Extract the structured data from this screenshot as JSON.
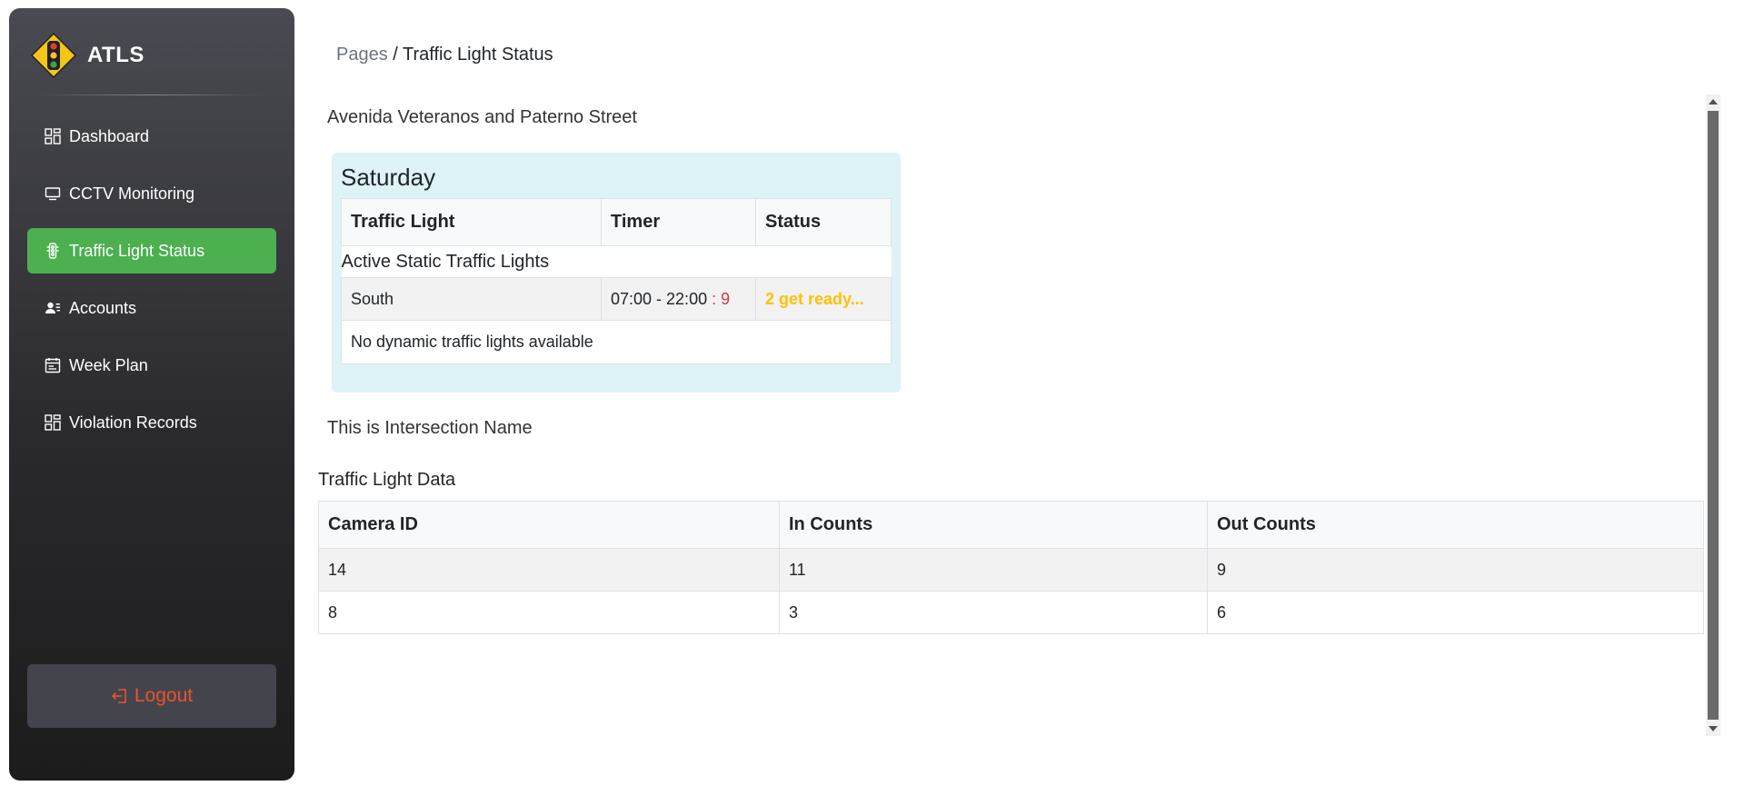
{
  "app": {
    "name": "ATLS",
    "colors": {
      "accent": "#4caf50",
      "logout": "#e8542c",
      "card_bg": "#ddf3f5",
      "status_warning": "#ffc107",
      "timer_remaining": "#dc3545"
    }
  },
  "sidebar": {
    "items": [
      {
        "label": "Dashboard",
        "icon": "dashboard-icon"
      },
      {
        "label": "CCTV Monitoring",
        "icon": "monitor-icon"
      },
      {
        "label": "Traffic Light Status",
        "icon": "traffic-light-icon",
        "active": true
      },
      {
        "label": "Accounts",
        "icon": "accounts-icon"
      },
      {
        "label": "Week Plan",
        "icon": "calendar-icon"
      },
      {
        "label": "Violation Records",
        "icon": "records-icon"
      }
    ],
    "logout_label": "Logout"
  },
  "breadcrumb": {
    "parent": "Pages",
    "separator": " / ",
    "current": "Traffic Light Status"
  },
  "main": {
    "intersection_title": "Avenida Veteranos and Paterno Street",
    "schedule": {
      "day": "Saturday",
      "headers": [
        "Traffic Light",
        "Timer",
        "Status"
      ],
      "static_section_label": "Active Static Traffic Lights",
      "static_rows": [
        {
          "light": "South",
          "timer": "07:00 - 22:00",
          "timer_sep": " : ",
          "remaining": "9",
          "status": "2 get ready..."
        }
      ],
      "dynamic_empty": "No dynamic traffic lights available"
    },
    "intersection_name": "This is Intersection Name",
    "data_title": "Traffic Light Data",
    "data_headers": [
      "Camera ID",
      "In Counts",
      "Out Counts"
    ],
    "data_rows": [
      [
        "14",
        "11",
        "9"
      ],
      [
        "8",
        "3",
        "6"
      ]
    ]
  }
}
